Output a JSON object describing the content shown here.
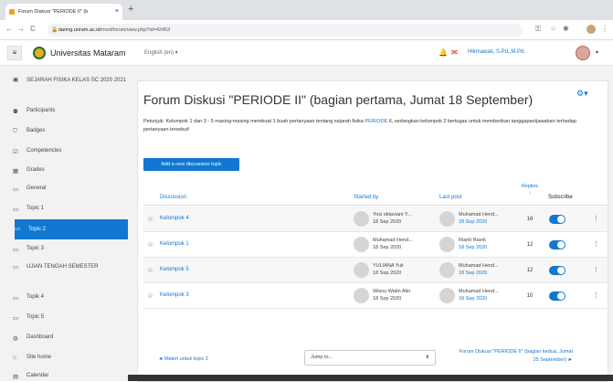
{
  "browser": {
    "tab_title": "Forum Diskusi \"PERIODE II\" (b",
    "tab_close": "×",
    "new_tab": "+",
    "back": "←",
    "forward": "→",
    "reload": "C",
    "url_domain": "daring.unram.ac.id",
    "url_path": "/mod/forum/view.php?id=42453"
  },
  "header": {
    "menu_icon": "≡",
    "site_name": "Universitas Mataram",
    "language": "English (en) ▾",
    "user_name": "Hikmawati, S.Pd.,M.Pd.",
    "user_caret": "▾"
  },
  "sidebar": {
    "items": [
      {
        "label": "SEJARAH FISIKA KELAS SC 2020 2021",
        "icon": "▣"
      },
      {
        "label": "Participants",
        "icon": "⚉"
      },
      {
        "label": "Badges",
        "icon": "⛉"
      },
      {
        "label": "Competencies",
        "icon": "☑"
      },
      {
        "label": "Grades",
        "icon": "▦"
      },
      {
        "label": "General",
        "icon": "▭"
      },
      {
        "label": "Topic 1",
        "icon": "▭"
      },
      {
        "label": "Topic 2",
        "icon": "▭"
      },
      {
        "label": "Topic 3",
        "icon": "▭"
      },
      {
        "label": "UJIAN TENGAH SEMESTER",
        "icon": "▭"
      },
      {
        "label": "Topik 4",
        "icon": "▭"
      },
      {
        "label": "Topic 5",
        "icon": "▭"
      },
      {
        "label": "Dashboard",
        "icon": "◍"
      },
      {
        "label": "Site home",
        "icon": "⌂"
      },
      {
        "label": "Calendar",
        "icon": "▤"
      }
    ]
  },
  "forum": {
    "title": "Forum Diskusi \"PERIODE II\" (bagian pertama, Jumat 18 September)",
    "desc_before": "Petunjuk: Kelompok 1 dan 3 - 5 masing-masing membuat 1 buah pertanyaan tentang sejarah fisika ",
    "desc_link": "PERIODE",
    "desc_after": " II, sedangkan kelompok 2 bertugas untuk memberikan tanggapan/jawaban terhadap pertanyaan tersebut!",
    "add_button": "Add a new discussion topic",
    "columns": {
      "discussion": "Discussion",
      "started_by": "Started by",
      "last_post": "Last post",
      "replies": "Replies",
      "replies_sort": "↓",
      "subscribe": "Subscribe"
    },
    "rows": [
      {
        "topic": "Kelompok 4",
        "starter": "Yosi oktaviani Y...",
        "start_date": "18 Sep 2020",
        "last_name": "Muhamad Hend...",
        "last_date": "18 Sep 2020",
        "replies": "16"
      },
      {
        "topic": "Kelompok 1",
        "starter": "Muhamad Hend...",
        "start_date": "18 Sep 2020",
        "last_name": "Rianti Rianti",
        "last_date": "18 Sep 2020",
        "replies": "12"
      },
      {
        "topic": "Kelompok 5",
        "starter": "YULIANA Yuli",
        "start_date": "18 Sep 2020",
        "last_name": "Muhamad Hend...",
        "last_date": "18 Sep 2020",
        "replies": "12"
      },
      {
        "topic": "Kelompok 3",
        "starter": "Wisnu Watin Atin",
        "start_date": "18 Sep 2020",
        "last_name": "Muhamad Hend...",
        "last_date": "18 Sep 2020",
        "replies": "10"
      }
    ],
    "prev_link": "◄ Materi untuk topic 2",
    "jump_to": "Jump to...",
    "next_link": "Forum Diskusi \"PERIODE II\" (bagian kedua, Jumat 25 September) ►"
  }
}
